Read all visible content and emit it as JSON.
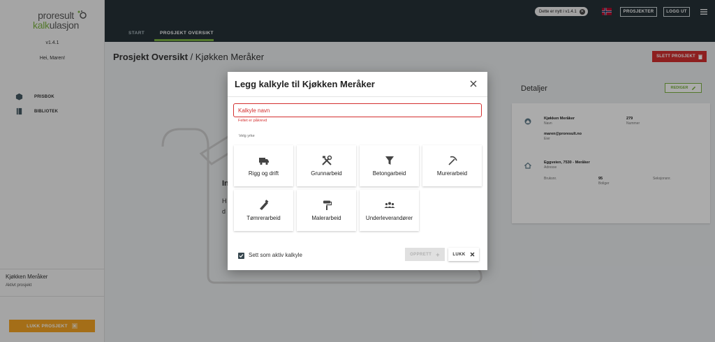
{
  "sidebar": {
    "logo": {
      "part1a": "pro",
      "part1b": "result",
      "part2a": "kalk",
      "part2b": "ulasjon"
    },
    "version": "v1.4.1",
    "greeting": "Hei, Maren!",
    "nav": [
      {
        "label": "PRISBOK",
        "icon": "cube-icon"
      },
      {
        "label": "BIBLIOTEK",
        "icon": "book-icon"
      }
    ],
    "active_project": {
      "name": "Kjøkken Meråker",
      "caption": "Aktivt prosjekt"
    },
    "close_project_label": "LUKK PROSJEKT"
  },
  "topbar": {
    "tabs": [
      {
        "label": "START"
      },
      {
        "label": "PROSJEKT OVERSIKT"
      }
    ],
    "news_pill": "Dette er nytt i v1.4.1",
    "projects_btn": "PROSJEKTER",
    "logout_btn": "LOGG UT"
  },
  "page": {
    "title": "Prosjekt Oversikt",
    "crumb": " / Kjøkken Meråker",
    "delete_btn": "SLETT PROSJEKT",
    "details_title": "Detaljer",
    "edit_btn": "REDIGER",
    "details": {
      "name": "Kjøkken Meråker",
      "name_caption": "Navn",
      "number": "279",
      "number_caption": "Nummer",
      "owner": "maren@proresult.no",
      "owner_caption": "Eier",
      "address": "Eggveien, 7530 - Meråker",
      "address_caption": "Adresse",
      "bruksnr_caption": "Bruksnr.",
      "units": "95",
      "units_caption": "Boliger",
      "seksjonsnr_caption": "Seksjonsnr."
    },
    "bg_heading_fragment": "In",
    "bg_text_fragment_1": "H",
    "bg_text_fragment_2": "d"
  },
  "modal": {
    "title": "Legg kalkyle til Kjøkken Meråker",
    "name_placeholder": "Kalkyle navn",
    "name_error": "Feltet er påkrevd",
    "pick_label": "Velg yrke",
    "trades": [
      {
        "label": "Rigg og drift",
        "icon": "truck-icon"
      },
      {
        "label": "Grunnarbeid",
        "icon": "tools-icon"
      },
      {
        "label": "Betongarbeid",
        "icon": "filter-icon"
      },
      {
        "label": "Murerarbeid",
        "icon": "pickaxe-icon"
      },
      {
        "label": "Tømrerarbeid",
        "icon": "saw-icon"
      },
      {
        "label": "Malerarbeid",
        "icon": "paint-roller-icon"
      },
      {
        "label": "Underleverandører",
        "icon": "people-icon"
      }
    ],
    "active_checkbox_label": "Sett som aktiv kalkyle",
    "create_btn": "OPPRETT",
    "close_btn": "LUKK"
  },
  "colors": {
    "brand_green": "#7cb342",
    "topbar": "#263238",
    "danger": "#d32f2f",
    "accent_orange": "#f5a524"
  }
}
